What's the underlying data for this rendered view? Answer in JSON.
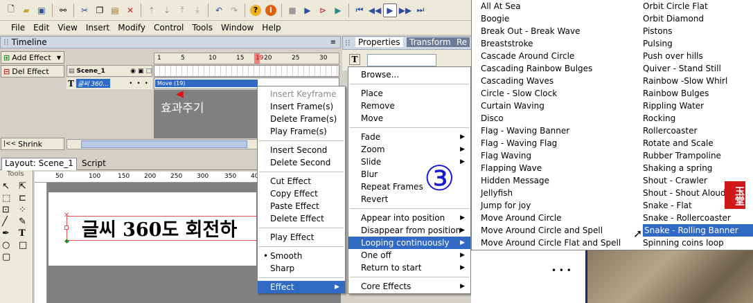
{
  "menubar": [
    "File",
    "Edit",
    "View",
    "Insert",
    "Modify",
    "Control",
    "Tools",
    "Window",
    "Help"
  ],
  "timeline": {
    "title": "Timeline",
    "add_effect": "Add Effect",
    "del_effect": "Del Effect",
    "shrink": "Shrink",
    "scene_label": "Scene_1",
    "layer_label": "글씨 360...",
    "ruler": [
      "1",
      "5",
      "10",
      "15",
      "19",
      "20",
      "25",
      "30"
    ],
    "move_bar": "Move (19)",
    "annotation": "효과주기"
  },
  "layout": {
    "tab1": "Layout: Scene_1",
    "tab2": "Script",
    "ruler": [
      "50",
      "100",
      "150",
      "200",
      "250",
      "300",
      "350",
      "400"
    ],
    "tools": "Tools",
    "canvas_text": "글씨 360도 회전하"
  },
  "properties_tabs": [
    "Properties",
    "Transform",
    "Re"
  ],
  "context_menu_1": {
    "g1": [
      "Insert Keyframe",
      "Insert Frame(s)",
      "Delete Frame(s)",
      "Play Frame(s)"
    ],
    "g2": [
      "Insert Second",
      "Delete Second"
    ],
    "g3": [
      "Cut Effect",
      "Copy Effect",
      "Paste Effect",
      "Delete Effect"
    ],
    "g4": [
      "Play Effect"
    ],
    "g5": [
      "Smooth",
      "Sharp"
    ],
    "effect": "Effect"
  },
  "context_menu_2": {
    "browse": "Browse...",
    "g1": [
      "Place",
      "Remove",
      "Move"
    ],
    "g2": [
      "Fade",
      "Zoom",
      "Slide",
      "Blur",
      "Repeat Frames",
      "Revert"
    ],
    "g3": [
      "Appear into position",
      "Disappear from position",
      "Looping continuously",
      "One off",
      "Return to start"
    ],
    "core": "Core Effects"
  },
  "circled_number": "③",
  "seal_text": "玉堂",
  "effects_col1": [
    "All At Sea",
    "Boogie",
    "Break Out - Break Wave",
    "Breaststroke",
    "Cascade Around Circle",
    "Cascading Rainbow Bulges",
    "Cascading Waves",
    "Circle - Slow Clock",
    "Curtain Waving",
    "Disco",
    "Flag - Waving Banner",
    "Flag - Waving Flag",
    "Flag Waving",
    "Flapping Wave",
    "Hidden Message",
    "Jellyfish",
    "Jump for joy",
    "Move Around Circle",
    "Move Around Circle and Spell",
    "Move Around Circle Flat and Spell"
  ],
  "effects_col2": [
    "Orbit Circle Flat",
    "Orbit Diamond",
    "Pistons",
    "Pulsing",
    "Push over hills",
    "Quiver - Stand Still",
    "Rainbow -Slow Whirl",
    "Rainbow Bulges",
    "Rippling Water",
    "Rocking",
    "Rollercoaster",
    "Rotate and Scale",
    "Rubber Trampoline",
    "Shaking a spring",
    "Shout - Crawler",
    "Shout - Shout Aloud",
    "Snake - Flat",
    "Snake - Rollercoaster",
    "Snake - Rolling Banner",
    "Spinning coins loop"
  ],
  "ellipsis": "• • •"
}
